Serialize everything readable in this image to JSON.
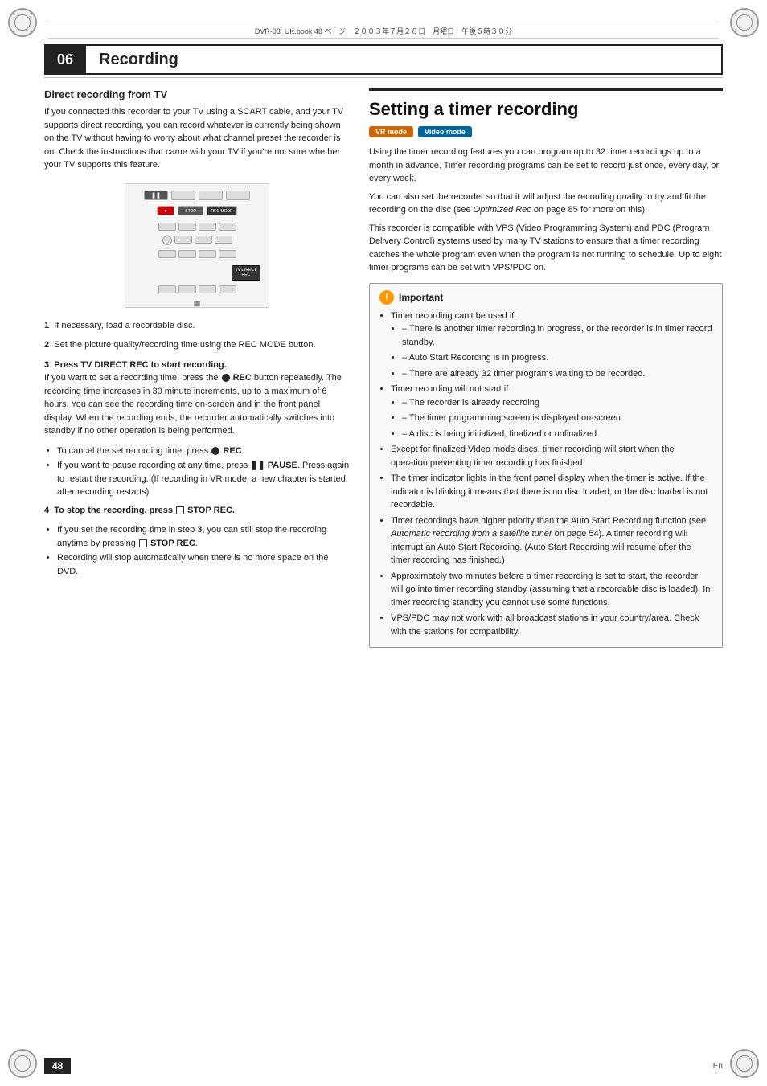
{
  "page": {
    "meta_bar": "DVR-03_UK.book  48 ページ　２００３年７月２８日　月曜日　午後６時３０分",
    "chapter_num": "06",
    "title": "Recording",
    "page_number": "48",
    "page_lang": "En"
  },
  "left": {
    "direct_recording_title": "Direct recording from TV",
    "direct_recording_intro": "If you connected this recorder to your TV using a SCART cable, and your TV supports direct recording, you can record whatever is currently being shown on the TV without having to worry about what channel preset the recorder is on. Check the instructions that came with your TV if you're not sure whether your TV supports this feature.",
    "step1": {
      "num": "1",
      "text": "If necessary, load a recordable disc."
    },
    "step2": {
      "num": "2",
      "text": "Set the picture quality/recording time using the REC MODE button."
    },
    "step3": {
      "num": "3",
      "title": "Press TV DIRECT REC to start recording.",
      "body": "If you want to set a recording time, press the ● REC button repeatedly. The recording time increases in 30 minute increments, up to a maximum of 6 hours. You can see the recording time on-screen and in the front panel display. When the recording ends, the recorder automatically switches into standby if no other operation is being performed."
    },
    "step3_bullets": [
      "To cancel the set recording time, press ● REC.",
      "If you want to pause recording at any time, press ❚❚ PAUSE. Press again to restart the recording. (If recording in VR mode, a new chapter is started after recording restarts)"
    ],
    "step4": {
      "num": "4",
      "title": "To stop the recording, press □ STOP REC.",
      "bullets": [
        "If you set the recording time in step 3, you can still stop the recording anytime by pressing □ STOP REC.",
        "Recording will stop automatically when there is no more space on the DVD."
      ]
    }
  },
  "right": {
    "section_title": "Setting a timer recording",
    "badge_vr": "VR mode",
    "badge_video": "Video mode",
    "para1": "Using the timer recording features you can program up to 32 timer recordings up to a month in advance. Timer recording programs can be set to record just once, every day, or every week.",
    "para2": "You can also set the recorder so that it will adjust the recording quality to try and fit the recording on the disc (see Optimized Rec on page 85 for more on this).",
    "para3": "This recorder is compatible with VPS (Video Programming System) and PDC (Program Delivery Control) systems used by many TV stations to ensure that a timer recording catches the whole program even when the program is not running to schedule. Up to eight timer programs can be set with VPS/PDC on.",
    "important_title": "Important",
    "important_bullets": [
      {
        "text": "Timer recording can't be used if:",
        "sub": [
          "There is another timer recording in progress, or the recorder is in timer record standby.",
          "Auto Start Recording is in progress.",
          "There are already 32 timer programs waiting to be recorded."
        ]
      },
      {
        "text": "Timer recording will not start if:",
        "sub": [
          "The recorder is already recording",
          "The timer programming screen is displayed on-screen",
          "A disc is being initialized, finalized or unfinalized."
        ]
      },
      {
        "text": "Except for finalized Video mode discs, timer recording will start when the operation preventing timer recording has finished.",
        "sub": []
      },
      {
        "text": "The timer indicator lights in the front panel display when the timer is active. If the indicator is blinking it means that there is no disc loaded, or the disc loaded is not recordable.",
        "sub": []
      },
      {
        "text": "Timer recordings have higher priority than the Auto Start Recording function (see Automatic recording from a satellite tuner on page 54). A timer recording will interrupt an Auto Start Recording. (Auto Start Recording will resume after the timer recording has finished.)",
        "sub": []
      },
      {
        "text": "Approximately two minutes before a timer recording is set to start, the recorder will go into timer recording standby (assuming that a recordable disc is loaded). In timer recording standby you cannot use some functions.",
        "sub": []
      },
      {
        "text": "VPS/PDC may not work with all broadcast stations in your country/area. Check with the stations for compatibility.",
        "sub": []
      }
    ]
  }
}
